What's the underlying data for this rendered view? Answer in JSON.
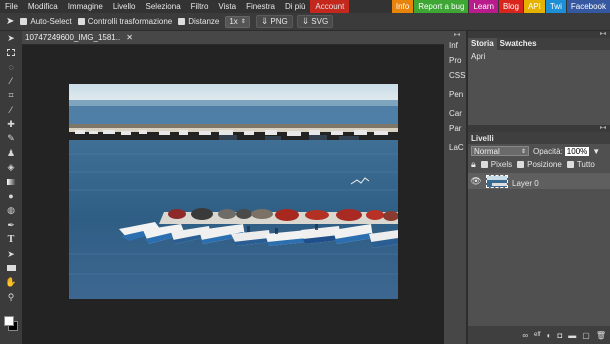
{
  "menu": {
    "items": [
      "File",
      "Modifica",
      "Immagine",
      "Livello",
      "Seleziona",
      "Filtro",
      "Vista",
      "Finestra",
      "Di più"
    ],
    "account": "Account",
    "links": [
      {
        "label": "Info",
        "color": "#e8830c"
      },
      {
        "label": "Report a bug",
        "color": "#3da634"
      },
      {
        "label": "Learn",
        "color": "#b81c8c"
      },
      {
        "label": "Blog",
        "color": "#d8261c"
      },
      {
        "label": "API",
        "color": "#e6b200"
      },
      {
        "label": "Twi",
        "color": "#1c8fd6"
      },
      {
        "label": "Facebook",
        "color": "#3658a0"
      }
    ]
  },
  "options": {
    "auto_select": "Auto-Select",
    "transform": "Controlli trasformazione",
    "distances": "Distanze",
    "zoom": "1x",
    "png": "PNG",
    "svg": "SVG"
  },
  "tools": [
    "move-tool",
    "marquee-tool",
    "lasso-tool",
    "magic-wand-tool",
    "crop-tool",
    "eyedropper-tool",
    "healing-tool",
    "brush-tool",
    "clone-stamp-tool",
    "eraser-tool",
    "gradient-tool",
    "blur-tool",
    "sponge-tool",
    "pen-tool",
    "text-tool",
    "path-select-tool",
    "shape-tool",
    "hand-tool",
    "zoom-tool"
  ],
  "document": {
    "tab_title": "10747249600_IMG_1581..",
    "close": "✕"
  },
  "side_tabs": [
    "Inf",
    "Pro",
    "CSS",
    "Pen",
    "Car",
    "Par",
    "LaC"
  ],
  "history": {
    "tabs": [
      "Storia",
      "Swatches"
    ],
    "entries": [
      "Apri"
    ]
  },
  "layers": {
    "title": "Livelli",
    "blend_mode": "Normal",
    "opacity_label": "Opacità:",
    "opacity_value": "100%",
    "locks": [
      "Pixels",
      "Posizione",
      "Tutto"
    ],
    "items": [
      {
        "name": "Layer 0"
      }
    ]
  },
  "colors": {
    "accent_account": "#c4271b",
    "canvas_bg": "#232323"
  }
}
